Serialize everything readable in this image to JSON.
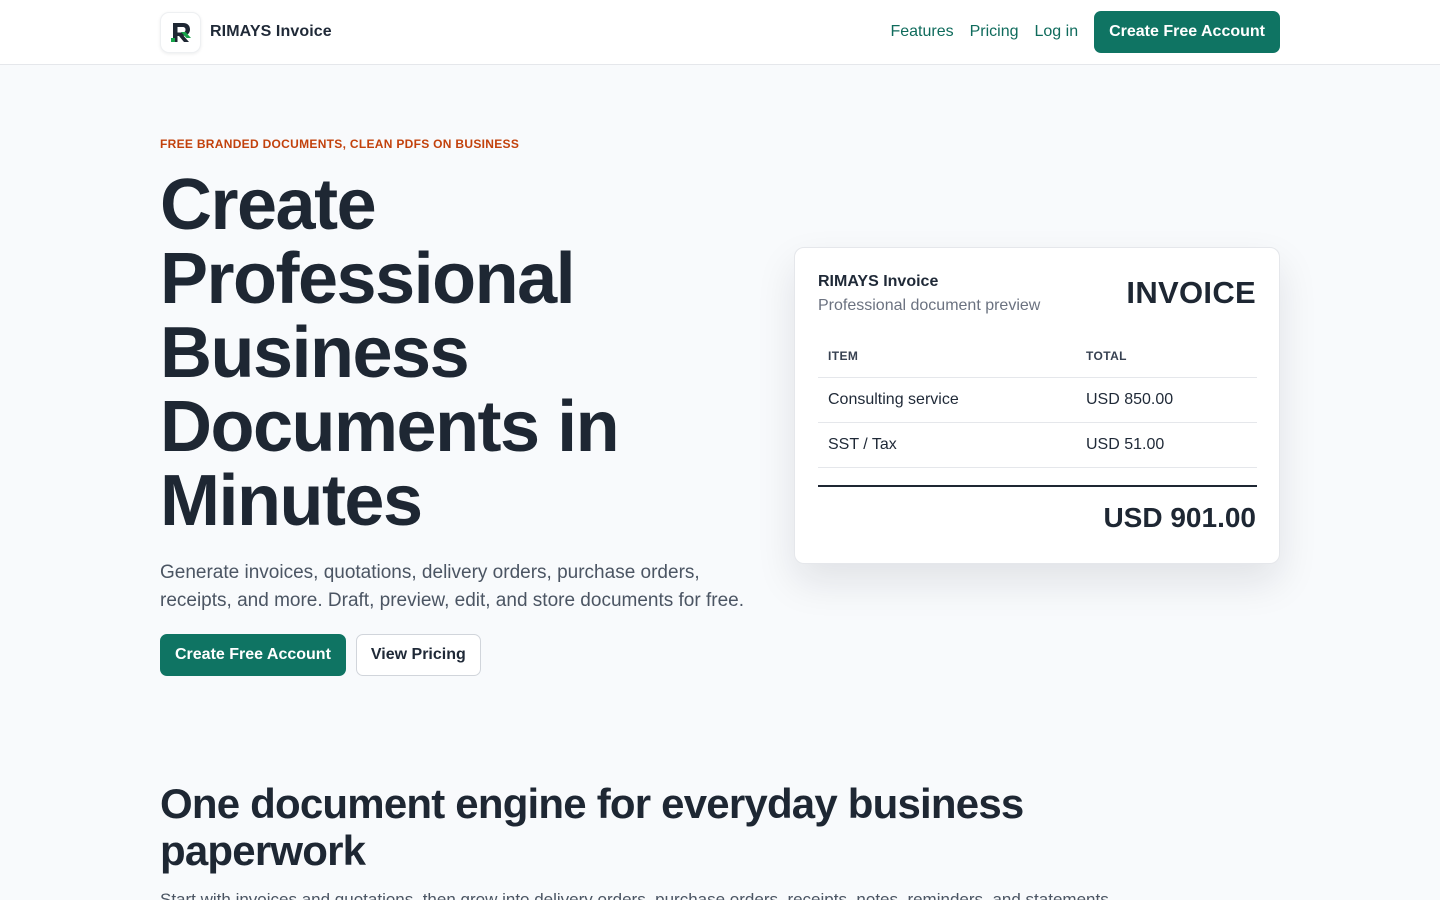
{
  "header": {
    "brand_name": "RIMAYS Invoice",
    "nav": {
      "features": "Features",
      "pricing": "Pricing",
      "login": "Log in",
      "cta": "Create Free Account"
    }
  },
  "hero": {
    "eyebrow": "FREE BRANDED DOCUMENTS, CLEAN PDFS ON BUSINESS",
    "title_lines": [
      "Create",
      "Professional",
      "Business",
      "Documents in",
      "Minutes"
    ],
    "subtitle": "Generate invoices, quotations, delivery orders, purchase orders, receipts, and more. Draft, preview, edit, and store documents for free.",
    "primary_button": "Create Free Account",
    "secondary_button": "View Pricing"
  },
  "invoice_preview": {
    "company": "RIMAYS Invoice",
    "subtitle": "Professional document preview",
    "doc_title": "INVOICE",
    "columns": [
      "ITEM",
      "TOTAL"
    ],
    "rows": [
      {
        "item": "Consulting service",
        "total": "USD 850.00"
      },
      {
        "item": "SST / Tax",
        "total": "USD 51.00"
      }
    ],
    "grand_total": "USD 901.00"
  },
  "section": {
    "title": "One document engine for everyday business paperwork",
    "subtitle": "Start with invoices and quotations, then grow into delivery orders, purchase orders, receipts, notes, reminders, and statements."
  },
  "colors": {
    "brand": "#0f7463",
    "accent": "#c2410c",
    "text": "#1e2733",
    "background": "#f8fafc"
  },
  "icons": {
    "logo": "rimays-logo-icon"
  }
}
